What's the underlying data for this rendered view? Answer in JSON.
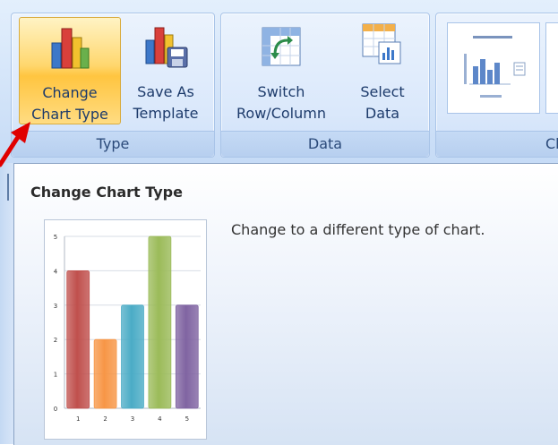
{
  "ribbon": {
    "groups": {
      "type": {
        "label": "Type"
      },
      "data": {
        "label": "Data"
      },
      "layouts": {
        "label": "Ch"
      }
    },
    "buttons": {
      "change_chart_type": {
        "line1": "Change",
        "line2": "Chart Type",
        "icon": "column-chart-icon",
        "active": true
      },
      "save_as_template": {
        "line1": "Save As",
        "line2": "Template",
        "icon": "chart-save-icon"
      },
      "switch_row_column": {
        "line1": "Switch",
        "line2": "Row/Column",
        "icon": "switch-row-column-icon"
      },
      "select_data": {
        "line1": "Select",
        "line2": "Data",
        "icon": "select-data-icon"
      }
    }
  },
  "tooltip": {
    "title": "Change Chart Type",
    "description": "Change to a different type of chart.",
    "preview_icon": "column-chart-preview"
  },
  "chart_data": {
    "type": "bar",
    "categories": [
      "1",
      "2",
      "3",
      "4",
      "5"
    ],
    "values": [
      4,
      2,
      3,
      5,
      3
    ],
    "ylim": [
      0,
      5
    ],
    "yticks": [
      "0",
      "1",
      "2",
      "3",
      "4",
      "5"
    ],
    "colors": [
      "#c0504d",
      "#f79646",
      "#4bacc6",
      "#9bbb59",
      "#8064a2"
    ],
    "grid": true
  },
  "colors": {
    "ribbon_bg": "#d3e4f9",
    "active_button": "#ffc540",
    "arrow": "#e00000"
  }
}
